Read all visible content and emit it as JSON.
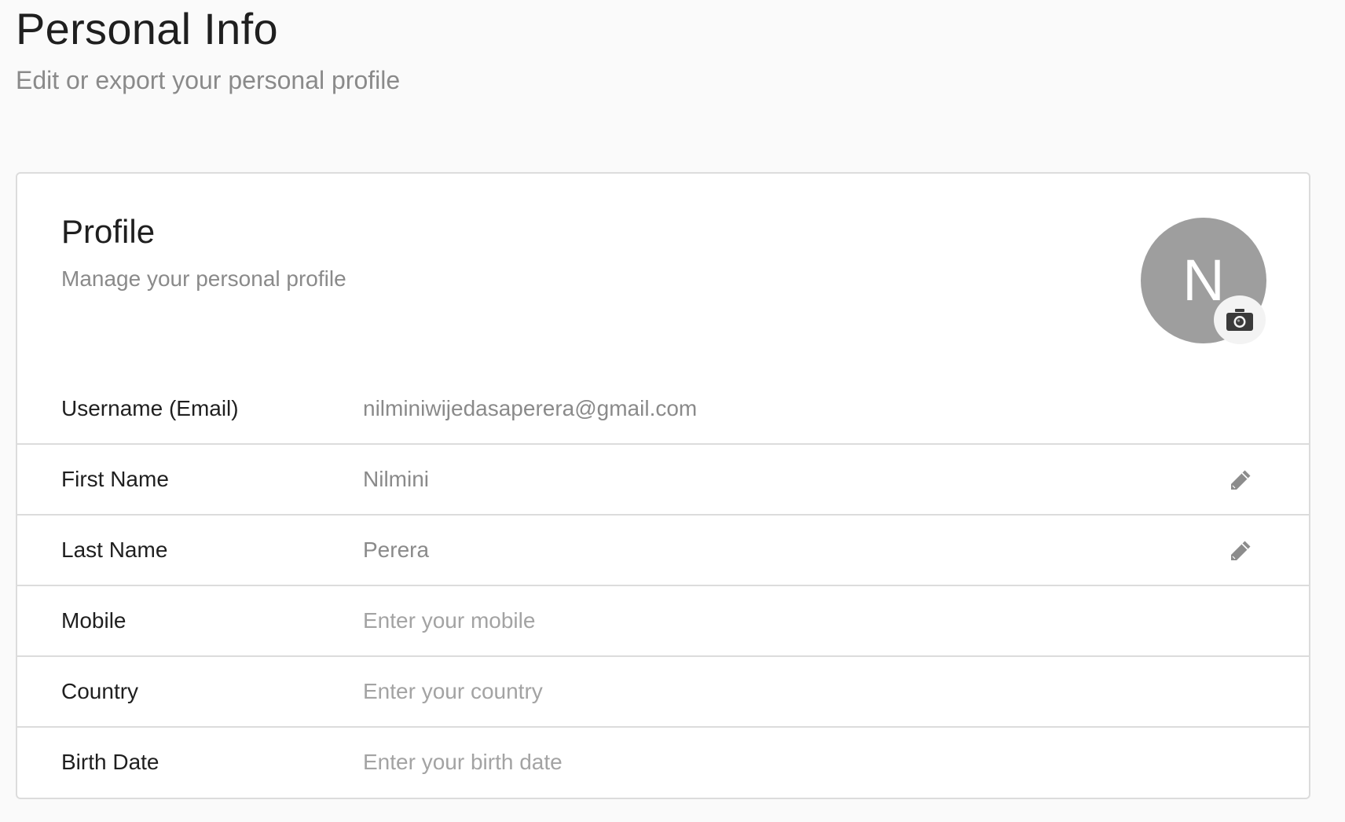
{
  "header": {
    "title": "Personal Info",
    "subtitle": "Edit or export your personal profile"
  },
  "profile": {
    "title": "Profile",
    "subtitle": "Manage your personal profile",
    "avatar_initial": "N",
    "avatar_color": "#9e9e9e",
    "camera_icon": "camera-icon",
    "edit_icon": "pencil-icon"
  },
  "fields": [
    {
      "label": "Username (Email)",
      "value": "nilminiwijedasaperera@gmail.com",
      "editable": false
    },
    {
      "label": "First Name",
      "value": "Nilmini",
      "editable": true
    },
    {
      "label": "Last Name",
      "value": "Perera",
      "editable": true
    },
    {
      "label": "Mobile",
      "placeholder": "Enter your mobile",
      "editable": false
    },
    {
      "label": "Country",
      "placeholder": "Enter your country",
      "editable": false
    },
    {
      "label": "Birth Date",
      "placeholder": "Enter your birth date",
      "editable": false
    }
  ]
}
